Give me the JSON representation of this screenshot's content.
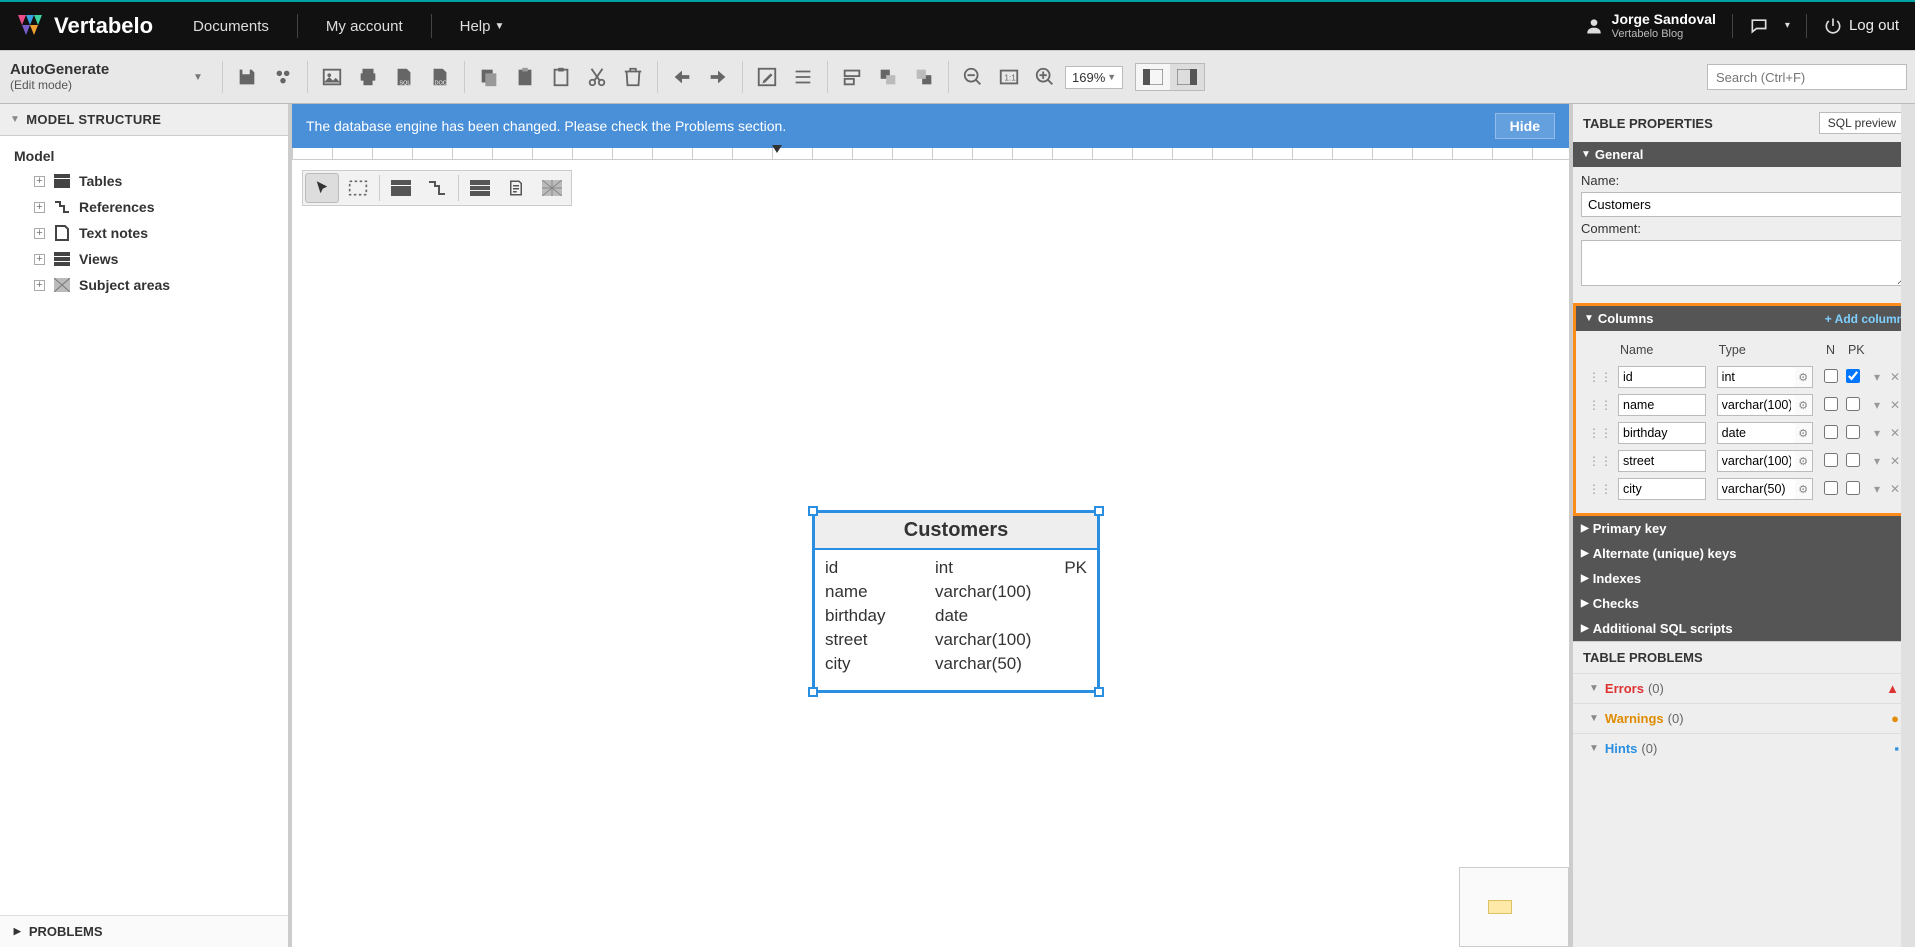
{
  "top": {
    "brand": "Vertabelo",
    "menu": [
      "Documents",
      "My account",
      "Help"
    ],
    "user_name": "Jorge Sandoval",
    "user_sub": "Vertabelo Blog",
    "logout": "Log out"
  },
  "doc": {
    "name": "AutoGenerate",
    "mode": "(Edit mode)",
    "zoom": "169%",
    "search_placeholder": "Search (Ctrl+F)"
  },
  "left": {
    "title": "MODEL STRUCTURE",
    "root": "Model",
    "items": [
      "Tables",
      "References",
      "Text notes",
      "Views",
      "Subject areas"
    ],
    "problems": "PROBLEMS"
  },
  "banner": {
    "text": "The database engine has been changed. Please check the Problems section.",
    "hide": "Hide"
  },
  "entity": {
    "title": "Customers",
    "rows": [
      {
        "name": "id",
        "type": "int",
        "key": "PK"
      },
      {
        "name": "name",
        "type": "varchar(100)",
        "key": ""
      },
      {
        "name": "birthday",
        "type": "date",
        "key": ""
      },
      {
        "name": "street",
        "type": "varchar(100)",
        "key": ""
      },
      {
        "name": "city",
        "type": "varchar(50)",
        "key": ""
      }
    ]
  },
  "right": {
    "title": "TABLE PROPERTIES",
    "sqlpreview": "SQL preview",
    "sections": {
      "general": "General",
      "columns": "Columns",
      "add_column": "+ Add column",
      "primary_key": "Primary key",
      "alt_keys": "Alternate (unique) keys",
      "indexes": "Indexes",
      "checks": "Checks",
      "addl_sql": "Additional SQL scripts"
    },
    "general": {
      "name_label": "Name:",
      "name_value": "Customers",
      "comment_label": "Comment:",
      "comment_value": ""
    },
    "col_hdr": {
      "name": "Name",
      "type": "Type",
      "n": "N",
      "pk": "PK"
    },
    "columns": [
      {
        "name": "id",
        "type": "int",
        "n": false,
        "pk": true
      },
      {
        "name": "name",
        "type": "varchar(100)",
        "n": false,
        "pk": false
      },
      {
        "name": "birthday",
        "type": "date",
        "n": false,
        "pk": false
      },
      {
        "name": "street",
        "type": "varchar(100)",
        "n": false,
        "pk": false
      },
      {
        "name": "city",
        "type": "varchar(50)",
        "n": false,
        "pk": false
      }
    ],
    "problems_title": "TABLE PROBLEMS",
    "problems": {
      "errors_label": "Errors",
      "errors_count": "(0)",
      "warnings_label": "Warnings",
      "warnings_count": "(0)",
      "hints_label": "Hints",
      "hints_count": "(0)"
    }
  }
}
